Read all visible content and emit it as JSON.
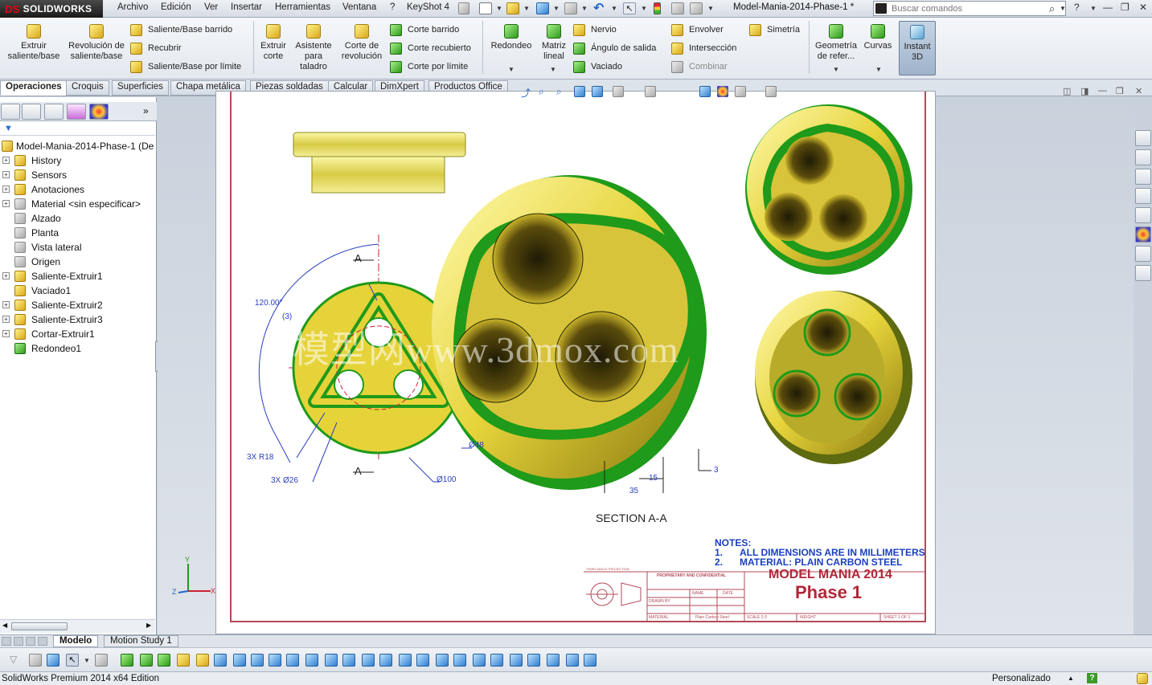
{
  "app": {
    "logo": "SOLIDWORKS",
    "document_title": "Model-Mania-2014-Phase-1 *"
  },
  "menu": [
    "Archivo",
    "Edición",
    "Ver",
    "Insertar",
    "Herramientas",
    "Ventana",
    "?",
    "KeyShot 4"
  ],
  "search": {
    "placeholder": "Buscar comandos"
  },
  "ribbon": {
    "extrude_boss": "Extruir saliente/base",
    "revolve_boss": "Revolución de saliente/base",
    "swept_boss": "Saliente/Base barrido",
    "wrap_cover": "Recubrir",
    "boundary_boss": "Saliente/Base por límite",
    "extruded_cut": "Extruir corte",
    "hole_wizard": "Asistente para taladro",
    "revolved_cut": "Corte de revolución",
    "swept_cut": "Corte barrido",
    "lofted_cut": "Corte recubierto",
    "boundary_cut": "Corte por límite",
    "fillet": "Redondeo",
    "linear_pattern": "Matriz lineal",
    "rib": "Nervio",
    "draft": "Ángulo de salida",
    "shell": "Vaciado",
    "wrap": "Envolver",
    "intersect": "Intersección",
    "combine": "Combinar",
    "mirror": "Simetría",
    "ref_geometry": "Geometría de refer...",
    "curves": "Curvas",
    "instant3d": "Instant 3D"
  },
  "tabs": [
    "Operaciones",
    "Croquis",
    "Superficies",
    "Chapa metálica",
    "Piezas soldadas",
    "Calcular",
    "DimXpert",
    "Productos Office"
  ],
  "tree": {
    "root": "Model-Mania-2014-Phase-1  (De",
    "items": [
      {
        "label": "History",
        "icon": "history-icon"
      },
      {
        "label": "Sensors",
        "icon": "sensor-icon"
      },
      {
        "label": "Anotaciones",
        "icon": "annotation-icon"
      },
      {
        "label": "Material <sin especificar>",
        "icon": "material-icon"
      },
      {
        "label": "Alzado",
        "icon": "plane-icon"
      },
      {
        "label": "Planta",
        "icon": "plane-icon"
      },
      {
        "label": "Vista lateral",
        "icon": "plane-icon"
      },
      {
        "label": "Origen",
        "icon": "origin-icon"
      },
      {
        "label": "Saliente-Extruir1",
        "icon": "extrude-icon"
      },
      {
        "label": "Vaciado1",
        "icon": "shell-icon"
      },
      {
        "label": "Saliente-Extruir2",
        "icon": "extrude-icon"
      },
      {
        "label": "Saliente-Extruir3",
        "icon": "extrude-icon"
      },
      {
        "label": "Cortar-Extruir1",
        "icon": "cut-icon"
      },
      {
        "label": "Redondeo1",
        "icon": "fillet-icon"
      }
    ]
  },
  "drawing": {
    "section_label": "SECTION A-A",
    "notes_title": "NOTES:",
    "notes": [
      {
        "num": "1.",
        "text": "ALL DIMENSIONS ARE IN MILLIMETERS"
      },
      {
        "num": "2.",
        "text": "MATERIAL: PLAIN CARBON STEEL"
      }
    ],
    "title_line1": "MODEL MANIA 2014",
    "title_line2": "Phase 1",
    "dims": {
      "angle": "120.00°",
      "angle_count": "(3)",
      "radius": "3X R18",
      "hole_dia": "3X Ø26",
      "outer_dia": "Ø100",
      "inner_dia": "Ø48",
      "sec_15": "15",
      "sec_35": "35",
      "sec_3": "3",
      "section_mark": "A"
    },
    "title_block": {
      "projection": "THIRD ANGLE PROJECTION",
      "proprietary": "PROPRIETARY AND CONFIDENTIAL",
      "drawn_by": "DRAWN BY",
      "material": "MATERIAL",
      "material_value": "Plain Carbon Steel",
      "name_hdr": "NAME",
      "date_hdr": "DATE",
      "scale": "SCALE 2:3",
      "weight": "WEIGHT",
      "sheet": "SHEET 1 OF 1"
    },
    "watermark": "模型网www.3dmox.com"
  },
  "bottom_tabs": [
    "Modelo",
    "Motion Study 1"
  ],
  "status": {
    "left": "SolidWorks Premium 2014 x64 Edition",
    "right": "Personalizado"
  },
  "colors": {
    "part_yellow": "#e6d33a",
    "part_green": "#1f9a1a",
    "drawing_blue": "#2a3fbf",
    "title_red": "#b0283a",
    "frame_red": "#b24a5a"
  }
}
